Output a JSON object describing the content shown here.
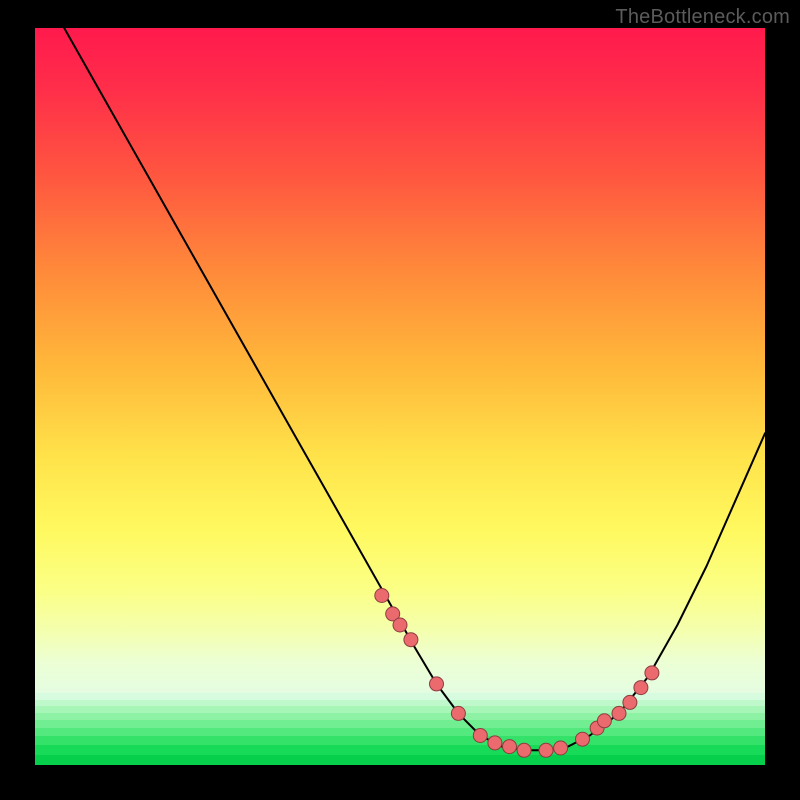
{
  "watermark": "TheBottleneck.com",
  "colors": {
    "dot_fill": "#eb6a6e",
    "dot_stroke": "#8e3d40",
    "curve": "#000000",
    "bg_black": "#000000",
    "watermark": "#5b5b5b"
  },
  "chart_data": {
    "type": "line",
    "title": "",
    "xlabel": "",
    "ylabel": "",
    "xlim": [
      0,
      100
    ],
    "ylim": [
      0,
      100
    ],
    "grid": false,
    "legend": false,
    "series": [
      {
        "name": "curve",
        "x": [
          4,
          8,
          12,
          16,
          20,
          24,
          28,
          32,
          36,
          40,
          44,
          48,
          52,
          55,
          58,
          61,
          64,
          67,
          70,
          73,
          76,
          80,
          84,
          88,
          92,
          96,
          100
        ],
        "y": [
          100,
          93,
          86,
          79,
          72,
          65,
          58,
          51,
          44,
          37,
          30,
          23,
          16,
          11,
          7,
          4,
          2.5,
          2,
          2,
          2.5,
          4,
          7,
          12,
          19,
          27,
          36,
          45
        ]
      }
    ],
    "dots": {
      "name": "highlighted-points",
      "x": [
        47.5,
        49,
        50,
        51.5,
        55,
        58,
        61,
        63,
        65,
        67,
        70,
        72,
        75,
        77,
        78,
        80,
        81.5,
        83,
        84.5
      ],
      "y": [
        23,
        20.5,
        19,
        17,
        11,
        7,
        4,
        3,
        2.5,
        2,
        2,
        2.3,
        3.5,
        5,
        6,
        7,
        8.5,
        10.5,
        12.5
      ]
    },
    "bottom_stripes": [
      {
        "color": "#d6fbde",
        "h": 0.8
      },
      {
        "color": "#bff9cb",
        "h": 0.8
      },
      {
        "color": "#a7f6b8",
        "h": 0.8
      },
      {
        "color": "#8ef2a5",
        "h": 0.9
      },
      {
        "color": "#72ee92",
        "h": 0.9
      },
      {
        "color": "#54e97e",
        "h": 1.0
      },
      {
        "color": "#34e26a",
        "h": 1.1
      },
      {
        "color": "#17da58",
        "h": 1.2
      },
      {
        "color": "#05cf4b",
        "h": 1.2
      }
    ],
    "gradient_stops": [
      {
        "pos": 0,
        "color": "#ff1a4d"
      },
      {
        "pos": 0.08,
        "color": "#ff2d4a"
      },
      {
        "pos": 0.2,
        "color": "#ff5640"
      },
      {
        "pos": 0.33,
        "color": "#ff8a3a"
      },
      {
        "pos": 0.46,
        "color": "#ffb83a"
      },
      {
        "pos": 0.58,
        "color": "#ffe24a"
      },
      {
        "pos": 0.68,
        "color": "#fff95f"
      },
      {
        "pos": 0.76,
        "color": "#fbff84"
      },
      {
        "pos": 0.82,
        "color": "#f4ffb0"
      },
      {
        "pos": 0.86,
        "color": "#ecffd4"
      },
      {
        "pos": 0.905,
        "color": "#e4fce2"
      }
    ]
  }
}
